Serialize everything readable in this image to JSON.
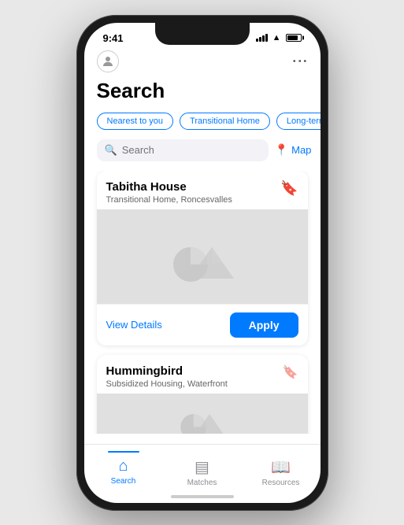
{
  "status": {
    "time": "9:41"
  },
  "header": {
    "title": "Search"
  },
  "filters": {
    "chips": [
      {
        "label": "Nearest to you"
      },
      {
        "label": "Transitional Home"
      },
      {
        "label": "Long-term Ho..."
      }
    ]
  },
  "search": {
    "placeholder": "Search"
  },
  "map_button": {
    "label": "Map"
  },
  "cards": [
    {
      "title": "Tabitha House",
      "subtitle": "Transitional Home, Roncesvalles",
      "view_details_label": "View Details",
      "apply_label": "Apply"
    },
    {
      "title": "Hummingbird",
      "subtitle": "Subsidized Housing, Waterfront"
    }
  ],
  "nav": {
    "items": [
      {
        "label": "Search",
        "active": true
      },
      {
        "label": "Matches",
        "active": false
      },
      {
        "label": "Resources",
        "active": false
      }
    ]
  }
}
